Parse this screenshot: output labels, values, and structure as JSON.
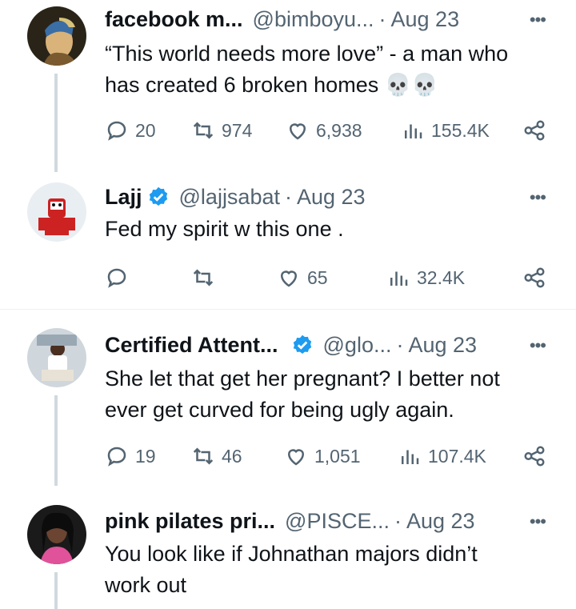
{
  "tweets": [
    {
      "name": "facebook m...",
      "handle": "@bimboyu...",
      "time": "Aug 23",
      "text_lines": [
        "“This world needs more love” - a man who",
        "has created 6 broken homes 💀💀"
      ],
      "replies": "20",
      "retweets": "974",
      "likes": "6,938",
      "views": "155.4K",
      "verified": false
    },
    {
      "name": "Lajj",
      "handle": "@lajjsabat",
      "time": "Aug 23",
      "text_lines": [
        "Fed my spirit w this one ."
      ],
      "replies": "",
      "retweets": "",
      "likes": "65",
      "views": "32.4K",
      "verified": true
    },
    {
      "name": "Certified Attent...",
      "handle": "@glo...",
      "time": "Aug 23",
      "text_lines": [
        "She let that get her pregnant? I better not",
        "ever get curved for being ugly again."
      ],
      "replies": "19",
      "retweets": "46",
      "likes": "1,051",
      "views": "107.4K",
      "verified": true
    },
    {
      "name": "pink pilates pri...",
      "handle": "@PISCE...",
      "time": "Aug 23",
      "text_lines": [
        "You look like if Johnathan majors didn’t",
        "work out"
      ],
      "verified": false
    }
  ],
  "icons": {
    "reply": "reply-icon",
    "retweet": "retweet-icon",
    "like": "heart-icon",
    "views": "views-icon",
    "share": "share-icon",
    "more": "more-icon",
    "verified": "verified-badge-icon"
  },
  "colors": {
    "verified": "#1d9bf0",
    "muted": "#536471",
    "thread": "#cfd9de"
  }
}
